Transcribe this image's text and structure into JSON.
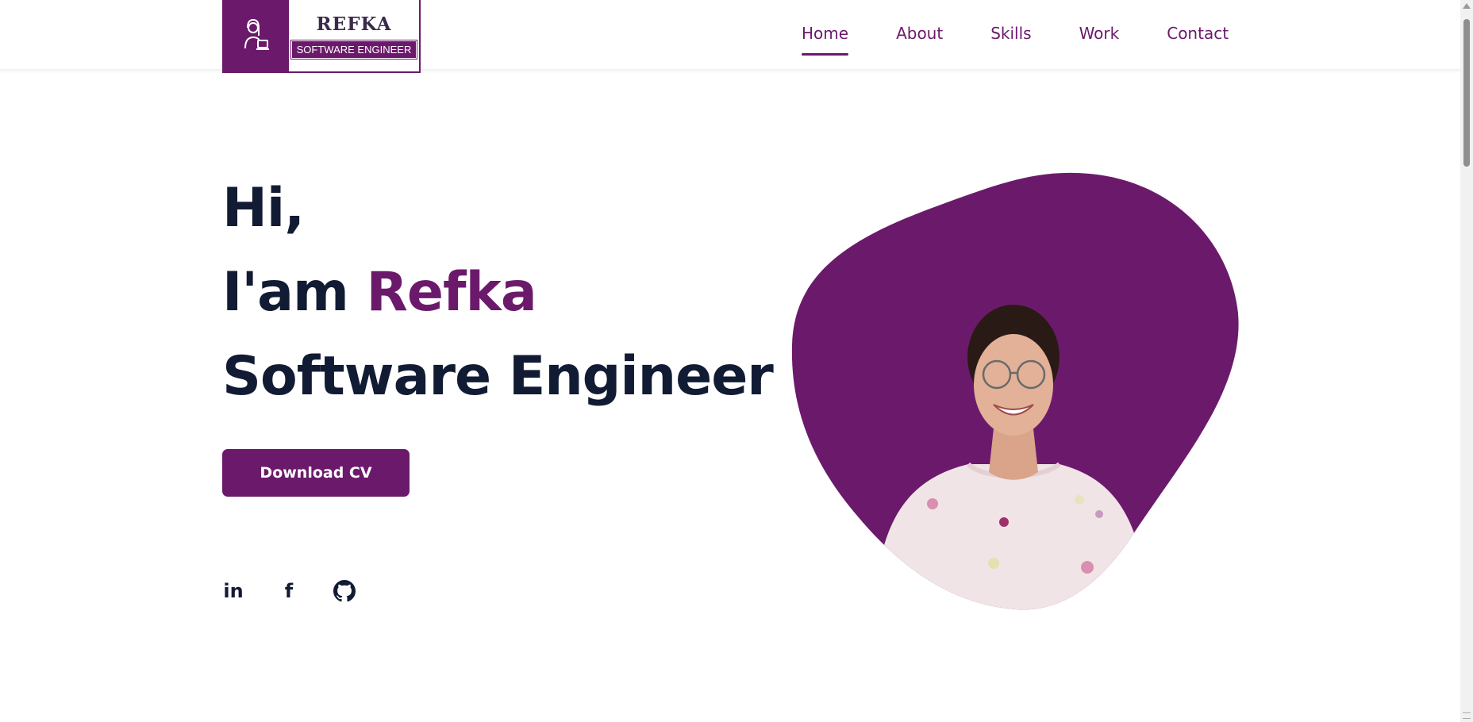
{
  "logo": {
    "name": "REFKA",
    "role": "SOFTWARE ENGINEER",
    "icon": "female-engineer-icon"
  },
  "nav": {
    "items": [
      {
        "label": "Home",
        "active": true
      },
      {
        "label": "About",
        "active": false
      },
      {
        "label": "Skills",
        "active": false
      },
      {
        "label": "Work",
        "active": false
      },
      {
        "label": "Contact",
        "active": false
      }
    ]
  },
  "hero": {
    "greeting": "Hi,",
    "intro_prefix": "I'am ",
    "name": "Refka",
    "role": "Software Engineer",
    "cv_button": "Download CV"
  },
  "socials": [
    {
      "label": "in",
      "icon": "linkedin-icon"
    },
    {
      "label": "f",
      "icon": "facebook-icon"
    },
    {
      "label": "",
      "icon": "github-icon"
    }
  ],
  "colors": {
    "brand": "#6b1a6b",
    "heading": "#111b33",
    "background": "#ffffff"
  }
}
